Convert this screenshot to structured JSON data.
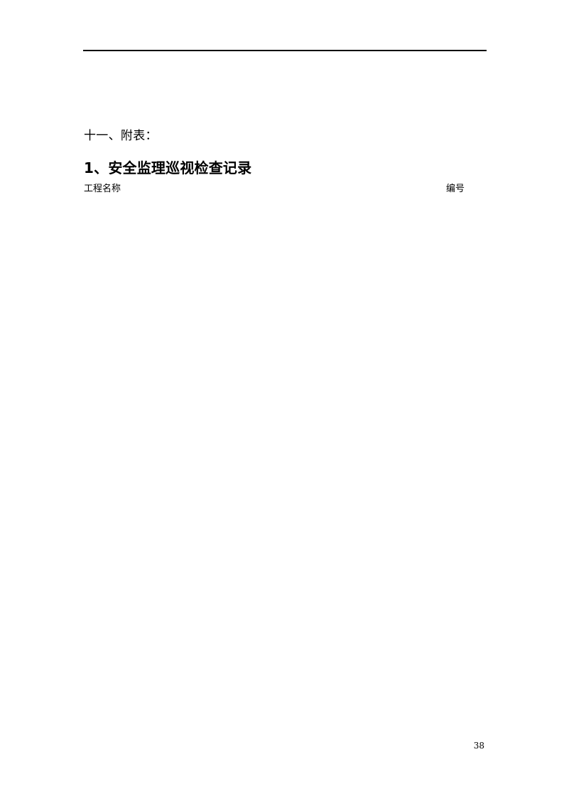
{
  "document": {
    "page_background": "#ffffff",
    "text_color": "#000000",
    "rule_color": "#000000"
  },
  "header": {
    "rule_present": true
  },
  "content": {
    "section_heading": "十一、附表：",
    "table_title": "1、安全监理巡视检查记录",
    "fields": {
      "project_name_label": "工程名称",
      "serial_number_label": "编号"
    }
  },
  "footer": {
    "page_number": "38"
  }
}
